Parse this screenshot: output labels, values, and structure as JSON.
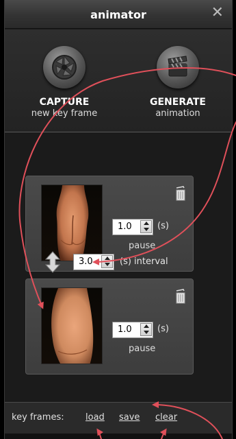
{
  "window": {
    "title": "animator",
    "close_icon": "close-icon"
  },
  "actions": [
    {
      "label": "CAPTURE",
      "sublabel": "new key frame",
      "icon": "camera-shutter-icon"
    },
    {
      "label": "GENERATE",
      "sublabel": "animation",
      "icon": "clapperboard-icon"
    }
  ],
  "keyframes": [
    {
      "pause_value": "1.0",
      "unit": "(s)",
      "pause_label": "pause"
    },
    {
      "pause_value": "1.0",
      "unit": "(s)",
      "pause_label": "pause"
    }
  ],
  "interval": {
    "value": "3.0",
    "label": "(s) interval"
  },
  "footer": {
    "label": "key frames:",
    "load": "load",
    "save": "save",
    "clear": "clear"
  },
  "colors": {
    "arrow": "#e0505a",
    "panel": "#1c1c1c",
    "card": "#444444"
  }
}
